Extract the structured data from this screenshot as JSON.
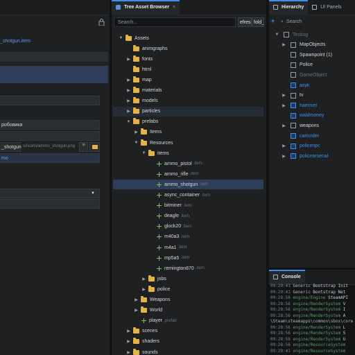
{
  "inspector": {
    "field_file": "_shotgun.item",
    "field_name": "робовика",
    "field_model_name": "_shotgun",
    "field_model_path": "ui/icons/ammo_shotgun.png",
    "field_ammo": "mo"
  },
  "tree": {
    "tab_label": "Tree Asset Browser",
    "close": "×",
    "search_placeholder": "Search...",
    "refresh_label": "efresh",
    "fold_label": "fold_i",
    "rows": [
      {
        "label": "Assets",
        "ext": "",
        "arrow": "▼",
        "kind": "folder"
      },
      {
        "label": "animgraphs",
        "ext": "",
        "arrow": "",
        "kind": "folder"
      },
      {
        "label": "fonts",
        "ext": "",
        "arrow": "▶",
        "kind": "folder"
      },
      {
        "label": "html",
        "ext": "",
        "arrow": "",
        "kind": "folder"
      },
      {
        "label": "map",
        "ext": "",
        "arrow": "▶",
        "kind": "folder"
      },
      {
        "label": "materials",
        "ext": "",
        "arrow": "▶",
        "kind": "folder"
      },
      {
        "label": "models",
        "ext": "",
        "arrow": "▶",
        "kind": "folder"
      },
      {
        "label": "particles",
        "ext": "",
        "arrow": "▶",
        "kind": "folder"
      },
      {
        "label": "prefabs",
        "ext": "",
        "arrow": "▼",
        "kind": "folder"
      },
      {
        "label": "Items",
        "ext": "",
        "arrow": "▶",
        "kind": "folder"
      },
      {
        "label": "Resources",
        "ext": "",
        "arrow": "▼",
        "kind": "folder"
      },
      {
        "label": "items",
        "ext": "",
        "arrow": "▼",
        "kind": "folder"
      },
      {
        "label": "ammo_pistol",
        "ext": ".item",
        "arrow": "",
        "kind": "asset"
      },
      {
        "label": "ammo_rifle",
        "ext": ".item",
        "arrow": "",
        "kind": "asset"
      },
      {
        "label": "ammo_shotgun",
        "ext": ".item",
        "arrow": "",
        "kind": "asset"
      },
      {
        "label": "async_container",
        "ext": ".item",
        "arrow": "",
        "kind": "asset"
      },
      {
        "label": "bitminer",
        "ext": ".item",
        "arrow": "",
        "kind": "asset"
      },
      {
        "label": "deagle",
        "ext": ".item",
        "arrow": "",
        "kind": "asset"
      },
      {
        "label": "glock20",
        "ext": ".item",
        "arrow": "",
        "kind": "asset"
      },
      {
        "label": "m40a3",
        "ext": ".item",
        "arrow": "",
        "kind": "asset"
      },
      {
        "label": "m4a1",
        "ext": ".item",
        "arrow": "",
        "kind": "asset"
      },
      {
        "label": "mp5a5",
        "ext": ".item",
        "arrow": "",
        "kind": "asset"
      },
      {
        "label": "remington870",
        "ext": ".item",
        "arrow": "",
        "kind": "asset"
      },
      {
        "label": "jobs",
        "ext": "",
        "arrow": "▶",
        "kind": "folder"
      },
      {
        "label": "police",
        "ext": "",
        "arrow": "▶",
        "kind": "folder"
      },
      {
        "label": "Weapons",
        "ext": "",
        "arrow": "▶",
        "kind": "folder"
      },
      {
        "label": "World",
        "ext": "",
        "arrow": "▶",
        "kind": "folder"
      },
      {
        "label": "player",
        "ext": ".prefab",
        "arrow": "",
        "kind": "asset"
      },
      {
        "label": "scenes",
        "ext": "",
        "arrow": "▶",
        "kind": "folder"
      },
      {
        "label": "shaders",
        "ext": "",
        "arrow": "▶",
        "kind": "folder"
      },
      {
        "label": "sounds",
        "ext": "",
        "arrow": "▶",
        "kind": "folder"
      }
    ]
  },
  "hierarchy": {
    "tab_label": "Hierarchy",
    "tab2_label": "UI Panels",
    "search_placeholder": "Search",
    "plus": "+",
    "rows": [
      {
        "label": "Testing",
        "arrow": "▼",
        "style": "dim"
      },
      {
        "label": "MapObjects",
        "arrow": "▶",
        "style": "normal"
      },
      {
        "label": "Spawnpoint (1)",
        "arrow": "",
        "style": "normal"
      },
      {
        "label": "Police",
        "arrow": "",
        "style": "normal"
      },
      {
        "label": "GameObject",
        "arrow": "",
        "style": "dim-blue"
      },
      {
        "label": "asyk",
        "arrow": "",
        "style": "blue"
      },
      {
        "label": "tv",
        "arrow": "▶",
        "style": "normal"
      },
      {
        "label": "hammer",
        "arrow": "▶",
        "style": "blue"
      },
      {
        "label": "waldmoney",
        "arrow": "",
        "style": "blue"
      },
      {
        "label": "weapons",
        "arrow": "▶",
        "style": "normal"
      },
      {
        "label": "cartorder",
        "arrow": "",
        "style": "blue"
      },
      {
        "label": "policenpc",
        "arrow": "▶",
        "style": "blue"
      },
      {
        "label": "policearsenal",
        "arrow": "▶",
        "style": "blue"
      }
    ]
  },
  "console": {
    "tab_label": "Console",
    "lines": [
      {
        "ts": "09:29:41",
        "src": "Generic",
        "msg": "Bootstrap Init"
      },
      {
        "ts": "09:29:41",
        "src": "Generic",
        "msg": "Bootstrap Net"
      },
      {
        "ts": "09:28:56",
        "src": "engine/Engine",
        "msg": "SteamAPI"
      },
      {
        "ts": "09:28:56",
        "src": "engine/RenderSystem",
        "msg": "V"
      },
      {
        "ts": "09:28:56",
        "src": "engine/RenderSystem",
        "msg": "I"
      },
      {
        "ts": "09:28:56",
        "src": "engine/RenderSystem",
        "msg": "A"
      },
      {
        "ts": "",
        "src": "\\Steam\\steamapps\\common\\sbox\\core",
        "msg": ""
      },
      {
        "ts": "09:28:56",
        "src": "engine/RenderSystem",
        "msg": "L"
      },
      {
        "ts": "09:28:56",
        "src": "engine/RenderSystem",
        "msg": "S"
      },
      {
        "ts": "09:28:56",
        "src": "engine/RenderSystem",
        "msg": "U"
      },
      {
        "ts": "09:28:56",
        "src": "engine/ResourceSystem",
        "msg": ""
      },
      {
        "ts": "09:29:41",
        "src": "engine/ResourceSystem",
        "msg": ""
      }
    ]
  }
}
